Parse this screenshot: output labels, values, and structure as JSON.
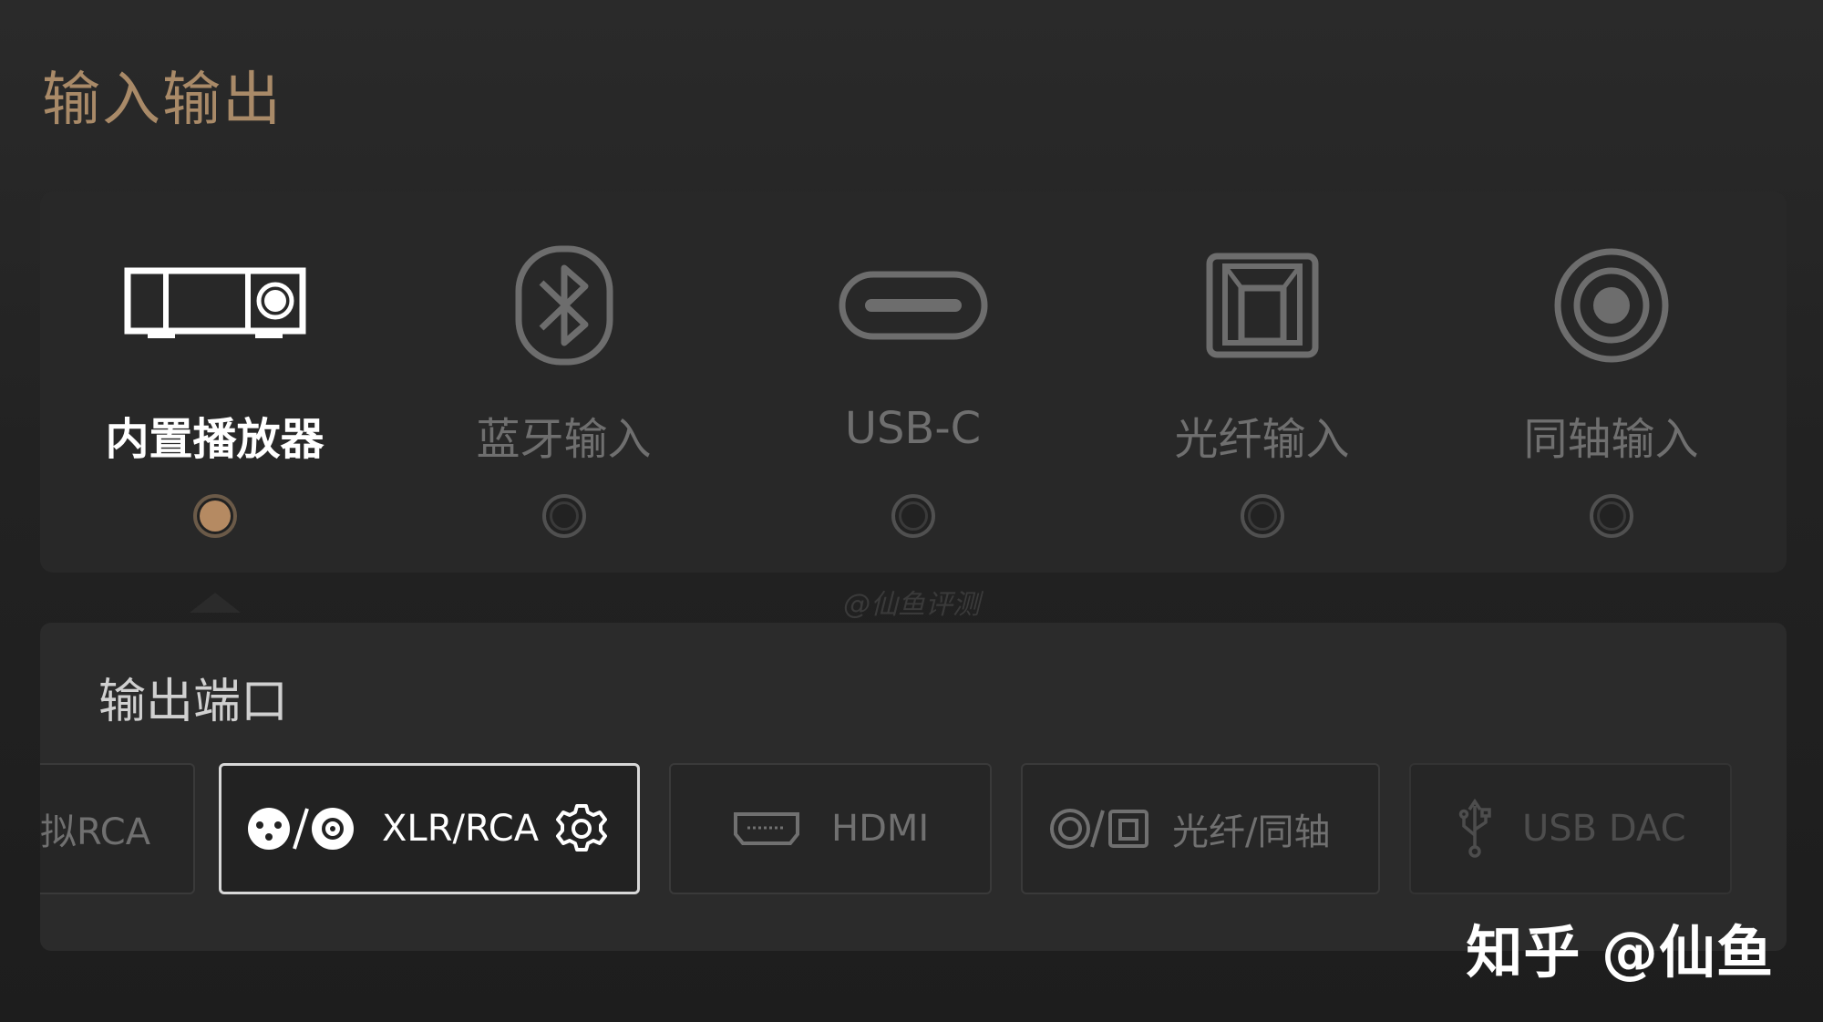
{
  "page": {
    "title": "输入输出"
  },
  "inputs": [
    {
      "label": "内置播放器",
      "icon": "player-device-icon",
      "selected": true
    },
    {
      "label": "蓝牙输入",
      "icon": "bluetooth-icon",
      "selected": false
    },
    {
      "label": "USB-C",
      "icon": "usb-c-port-icon",
      "selected": false
    },
    {
      "label": "光纤输入",
      "icon": "optical-port-icon",
      "selected": false
    },
    {
      "label": "同轴输入",
      "icon": "coaxial-port-icon",
      "selected": false
    }
  ],
  "watermark": "@仙鱼评测",
  "output": {
    "title": "输出端口",
    "ports": [
      {
        "label": "拟RCA",
        "icon": "",
        "state": "partial"
      },
      {
        "label": "XLR/RCA",
        "icon": "xlr-rca-icon",
        "state": "selected"
      },
      {
        "label": "HDMI",
        "icon": "hdmi-icon",
        "state": "normal"
      },
      {
        "label": "光纤/同轴",
        "icon": "optical-coaxial-icon",
        "state": "normal"
      },
      {
        "label": "USB DAC",
        "icon": "usb-icon",
        "state": "faded"
      }
    ]
  },
  "credit": "知乎 @仙鱼",
  "colors": {
    "accent": "#b58a62",
    "title": "#a98a68",
    "background": "#222222"
  }
}
